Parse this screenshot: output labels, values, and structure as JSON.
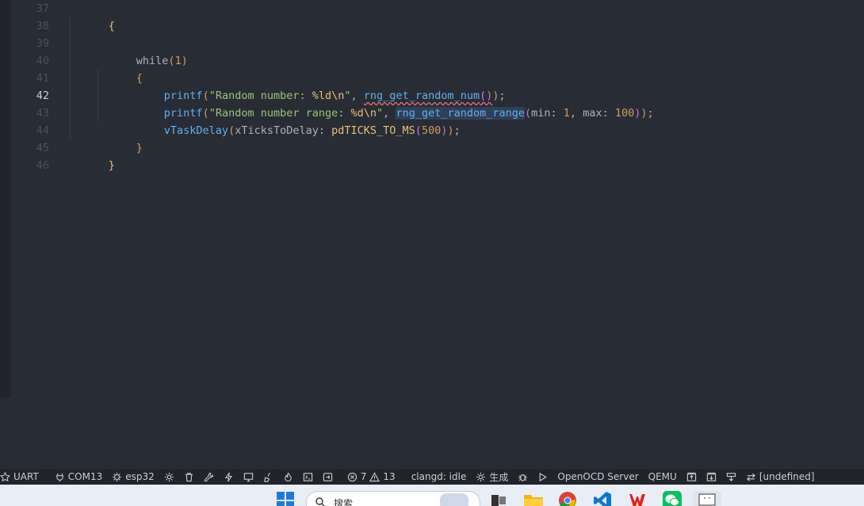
{
  "editor": {
    "line_numbers": [
      "37",
      "38",
      "39",
      "40",
      "41",
      "42",
      "43",
      "44",
      "45",
      "46"
    ],
    "active_line": "42",
    "code": {
      "l37_brace": "{",
      "l39_kw": "while",
      "l39_open": "(",
      "l39_num": "1",
      "l39_close": ")",
      "l40_brace": "{",
      "l41_fn": "printf",
      "l41_open": "(",
      "l41_str": "\"Random number: ",
      "l41_fmt": "%ld\\n",
      "l41_str_end": "\"",
      "l41_comma": ", ",
      "l41_call": "rng_get_random_num",
      "l41_inner": "()",
      "l41_close": ")",
      "l41_semi": ";",
      "l42_fn": "printf",
      "l42_open": "(",
      "l42_str": "\"Random number range: ",
      "l42_fmt": "%d\\n",
      "l42_str_end": "\"",
      "l42_comma": ", ",
      "l42_call": "rng_get_random_range",
      "l42_inner_open": "(",
      "l42_hint_min": "min:",
      "l42_num_min": " 1",
      "l42_sep": ", ",
      "l42_hint_max": "max:",
      "l42_num_max": " 100",
      "l42_inner_close": ")",
      "l42_close": ")",
      "l42_semi": ";",
      "l43_fn": "vTaskDelay",
      "l43_open": "(",
      "l43_hint": "xTicksToDelay:",
      "l43_macro": " pdTICKS_TO_MS",
      "l43_inner_open": "(",
      "l43_num": "500",
      "l43_inner_close": ")",
      "l43_close": ")",
      "l43_semi": ";",
      "l44_brace": "}",
      "l45_brace": "}"
    }
  },
  "statusbar": {
    "uart": "UART",
    "com": "COM13",
    "target": "esp32",
    "errors": "7",
    "warnings": "13",
    "clangd": "clangd: idle",
    "build": "生成",
    "openocd": "OpenOCD Server",
    "qemu": "QEMU",
    "undefined": "[undefined]"
  },
  "taskbar": {
    "search_placeholder": "搜索"
  },
  "colors": {
    "editor_bg": "#282c34",
    "status_bg": "#21252b",
    "taskbar_bg": "#e9eef6"
  }
}
